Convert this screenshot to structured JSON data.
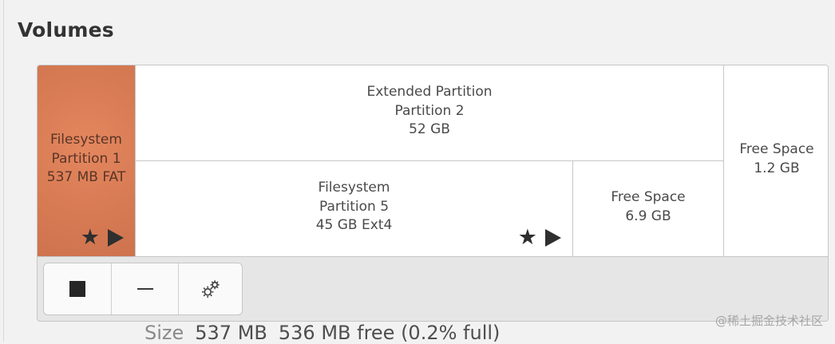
{
  "section": {
    "title": "Volumes"
  },
  "partitions": {
    "partition_1": {
      "line1": "Filesystem",
      "line2": "Partition 1",
      "line3": "537 MB FAT",
      "accent": "#d77b54"
    },
    "extended": {
      "line1": "Extended Partition",
      "line2": "Partition 2",
      "line3": "52 GB"
    },
    "partition_5": {
      "line1": "Filesystem",
      "line2": "Partition 5",
      "line3": "45 GB Ext4"
    },
    "free_inner": {
      "line1": "Free Space",
      "line2": "6.9 GB"
    },
    "free_outer": {
      "line1": "Free Space",
      "line2": "1.2 GB"
    }
  },
  "icons": {
    "star": "★",
    "play": "play-triangle",
    "stop": "stop-square",
    "minus": "minus",
    "gear": "gear"
  },
  "details": {
    "size_label": "Size",
    "size_value": "537 MB",
    "free_value": "536 MB free (0.2% full)"
  },
  "watermark": "@稀土掘金技术社区"
}
